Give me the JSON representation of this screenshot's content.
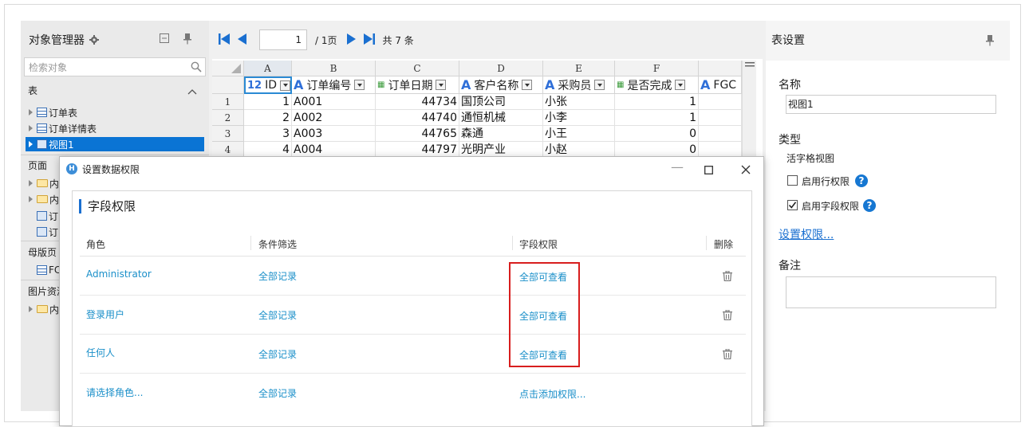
{
  "object_manager": {
    "title": "对象管理器",
    "search_placeholder": "检索对象",
    "tables_section": "表",
    "tables": [
      "订单表",
      "订单详情表",
      "视图1"
    ],
    "pages_section": "页面",
    "pages": [
      "内",
      "内",
      "订",
      "订"
    ],
    "master_section": "母版页",
    "master_items": [
      "FC"
    ],
    "images_section": "图片资源",
    "image_items": [
      "内"
    ]
  },
  "navigator": {
    "page_value": "1",
    "page_total": "/ 1页",
    "record_count": "共 7 条"
  },
  "sheet": {
    "columns": [
      "A",
      "B",
      "C",
      "D",
      "E",
      "F"
    ],
    "fields": [
      {
        "name": "ID",
        "icon": "12"
      },
      {
        "name": "订单编号",
        "icon": "A"
      },
      {
        "name": "订单日期",
        "icon": "date"
      },
      {
        "name": "客户名称",
        "icon": "A"
      },
      {
        "name": "采购员",
        "icon": "A"
      },
      {
        "name": "是否完成",
        "icon": "date"
      },
      {
        "name": "FGC",
        "icon": "A"
      }
    ],
    "row_numbers": [
      "1",
      "2",
      "3",
      "4"
    ],
    "rows": [
      [
        "1",
        "A001",
        "44734",
        "国顶公司",
        "小张",
        "1"
      ],
      [
        "2",
        "A002",
        "44740",
        "通恒机械",
        "小李",
        "1"
      ],
      [
        "3",
        "A003",
        "44765",
        "森通",
        "小王",
        "0"
      ],
      [
        "4",
        "A004",
        "44797",
        "光明产业",
        "小赵",
        "0"
      ]
    ]
  },
  "table_settings": {
    "title": "表设置",
    "name_label": "名称",
    "name_value": "视图1",
    "type_label": "类型",
    "type_value": "活字格视图",
    "row_permission_label": "启用行权限",
    "row_permission_checked": false,
    "field_permission_label": "启用字段权限",
    "field_permission_checked": true,
    "set_permission_link": "设置权限...",
    "remark_label": "备注"
  },
  "dialog": {
    "title": "设置数据权限",
    "section_title": "字段权限",
    "headers": {
      "role": "角色",
      "filter": "条件筛选",
      "field_perm": "字段权限",
      "delete": "删除"
    },
    "rows": [
      {
        "role": "Administrator",
        "filter": "全部记录",
        "perm": "全部可查看"
      },
      {
        "role": "登录用户",
        "filter": "全部记录",
        "perm": "全部可查看"
      },
      {
        "role": "任何人",
        "filter": "全部记录",
        "perm": "全部可查看"
      }
    ],
    "new_row": {
      "role": "请选择角色...",
      "filter": "全部记录",
      "perm": "点击添加权限..."
    }
  },
  "colors": {
    "accent": "#1a6fd0",
    "link": "#1a8fc9",
    "selection": "#0a74d4",
    "highlight_box": "#d81e1e"
  }
}
